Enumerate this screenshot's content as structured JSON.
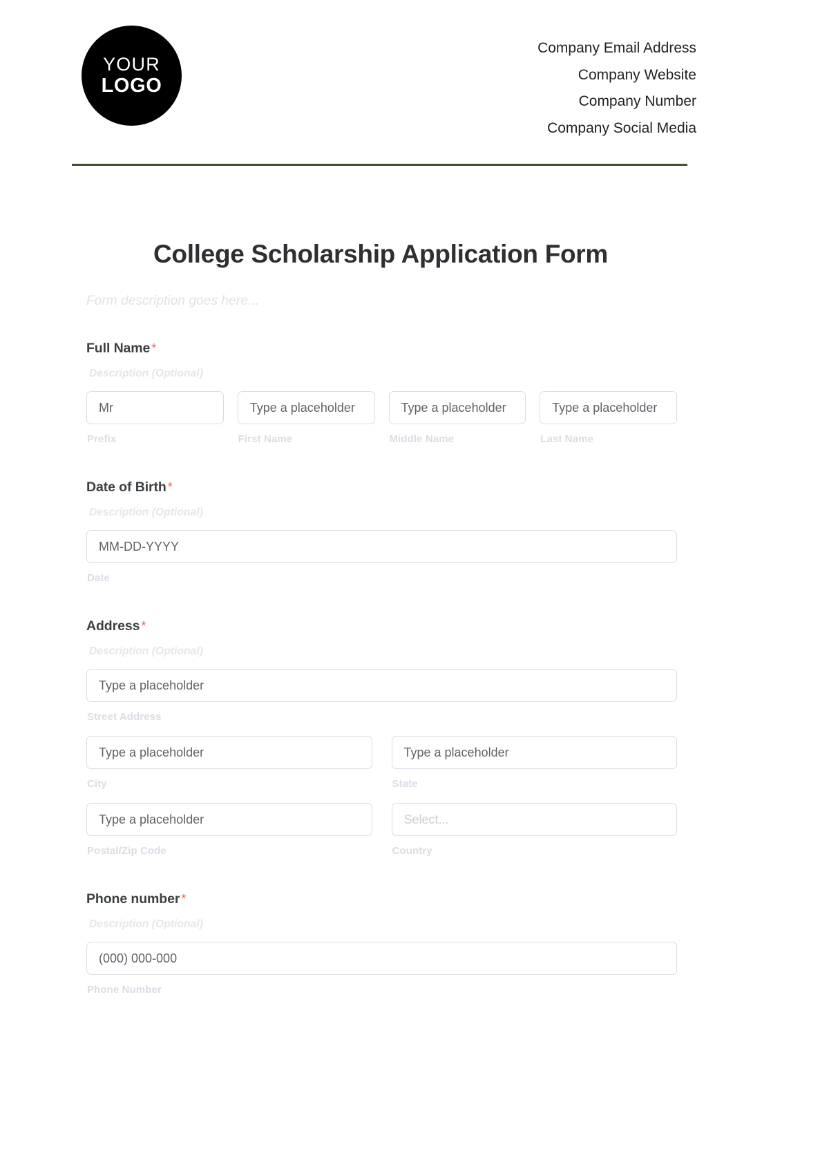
{
  "header": {
    "logo": {
      "line1": "YOUR",
      "line2": "LOGO"
    },
    "contact": [
      "Company Email Address",
      "Company Website",
      "Company Number",
      "Company Social Media"
    ]
  },
  "form": {
    "title": "College Scholarship Application Form",
    "description": "Form description goes here...",
    "required_marker": "*",
    "optional_hint": "Description (Optional)",
    "fields": {
      "full_name": {
        "label": "Full Name",
        "hint": "Description (Optional)",
        "parts": [
          {
            "value": "Mr",
            "sub_label": "Prefix"
          },
          {
            "value": "Type a placeholder",
            "sub_label": "First Name"
          },
          {
            "value": "Type a placeholder",
            "sub_label": "Middle Name"
          },
          {
            "value": "Type a placeholder",
            "sub_label": "Last Name"
          }
        ]
      },
      "date_of_birth": {
        "label": "Date of Birth",
        "hint": "Description (Optional)",
        "value": "MM-DD-YYYY",
        "sub_label": "Date"
      },
      "address": {
        "label": "Address",
        "hint": "Description (Optional)",
        "street": {
          "value": "Type a placeholder",
          "sub_label": "Street Address"
        },
        "city": {
          "value": "Type a placeholder",
          "sub_label": "City"
        },
        "state": {
          "value": "Type a placeholder",
          "sub_label": "State"
        },
        "postal": {
          "value": "Type a placeholder",
          "sub_label": "Postal/Zip Code"
        },
        "country": {
          "value": "Select...",
          "sub_label": "Country"
        }
      },
      "phone": {
        "label": "Phone number",
        "hint": "Description (Optional)",
        "value": "(000) 000-000",
        "sub_label": "Phone Number"
      }
    }
  },
  "colors": {
    "required": "#f4604a",
    "rule": "#4b4a33",
    "label": "#3c4043",
    "placeholder": "#5f6368",
    "muted": "#d9dde3"
  }
}
